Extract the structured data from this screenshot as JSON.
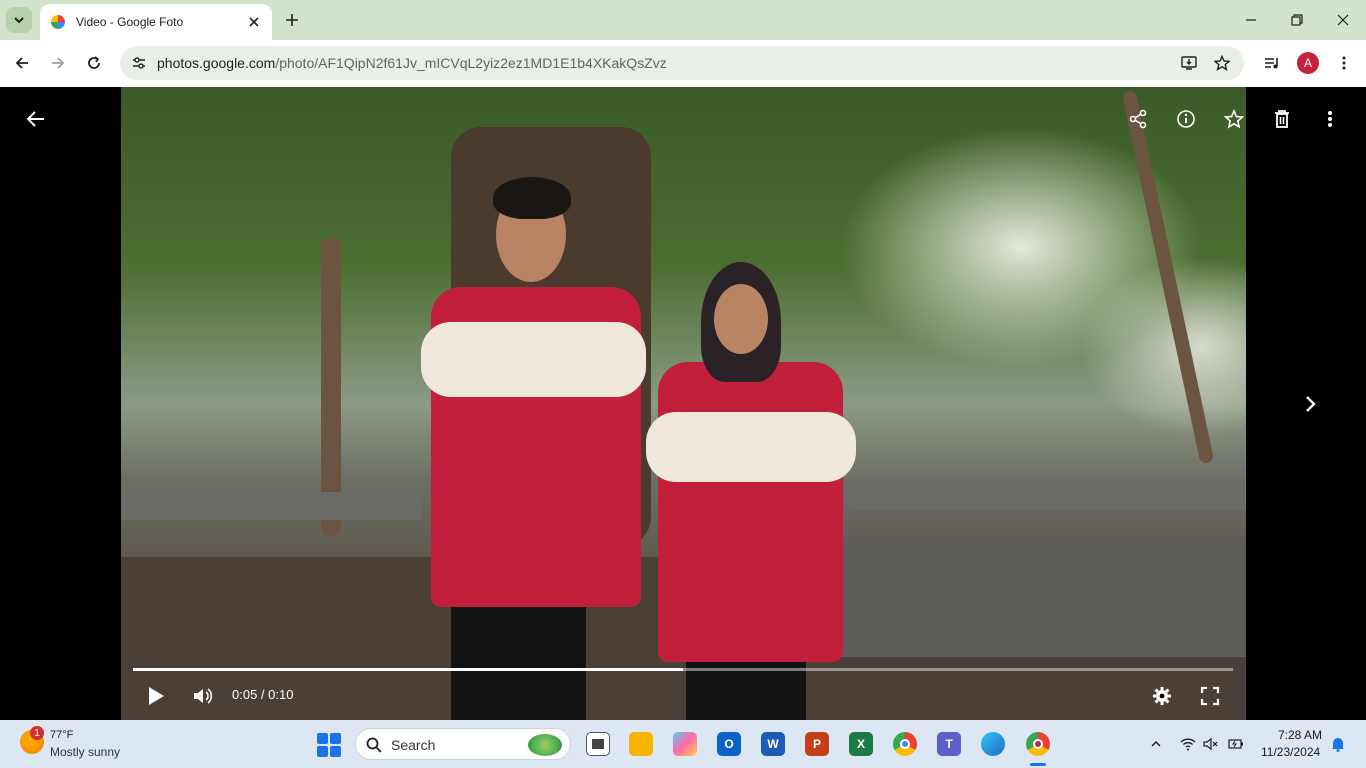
{
  "browser": {
    "tab_title": "Video - Google Foto",
    "url_host": "photos.google.com",
    "url_path": "/photo/AF1QipN2f61Jv_mICVqL2yiz2ez1MD1E1b4XKakQsZvz",
    "profile_initial": "A"
  },
  "player": {
    "time_display": "0:05 / 0:10",
    "progress_fraction": 0.5,
    "icons": [
      "back-arrow-icon",
      "share-icon",
      "info-icon",
      "star-icon",
      "trash-icon",
      "more-vert-icon",
      "next-chevron-icon",
      "play-icon",
      "volume-icon",
      "settings-gear-icon",
      "fullscreen-icon"
    ]
  },
  "taskbar": {
    "weather_badge": "1",
    "weather_temp": "77°F",
    "weather_desc": "Mostly sunny",
    "search_label": "Search",
    "clock_time": "7:28 AM",
    "clock_date": "11/23/2024"
  },
  "colors": {
    "chrome_tab_bar": "#d3e3cb",
    "omnibox": "#e9efe6",
    "profile": "#c5203e",
    "taskbar": "#dde6f3",
    "accent": "#1a73e8"
  }
}
